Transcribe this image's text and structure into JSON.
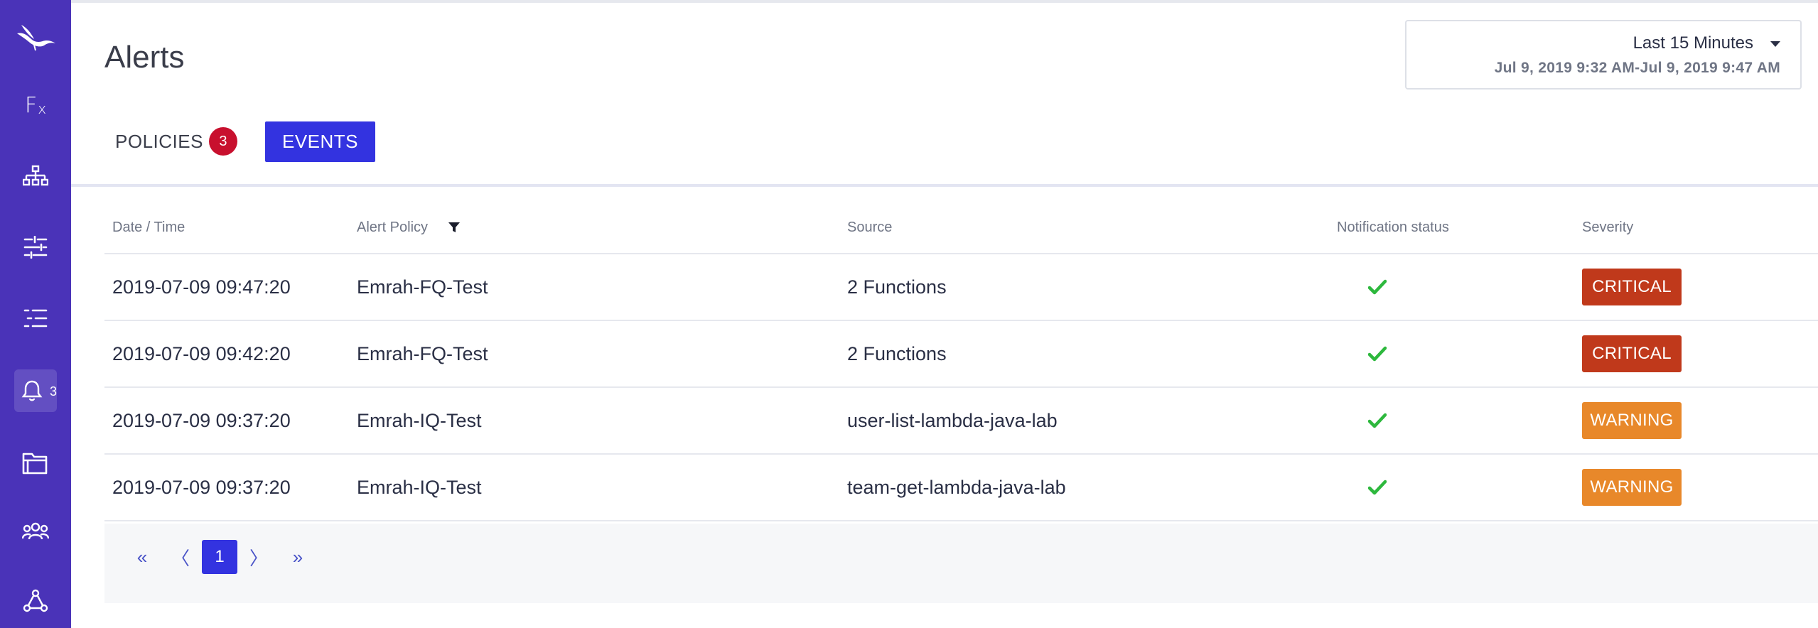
{
  "app": {
    "page_title": "Alerts"
  },
  "sidebar": {
    "accent_color": "#4a33b8",
    "items": [
      {
        "icon": "bird-logo-icon"
      },
      {
        "icon": "functions-icon",
        "label": "F",
        "sub": "x"
      },
      {
        "icon": "hierarchy-icon"
      },
      {
        "icon": "sliders-icon"
      },
      {
        "icon": "list-icon"
      },
      {
        "icon": "bell-icon",
        "badge": "3"
      },
      {
        "icon": "folder-icon"
      },
      {
        "icon": "team-icon"
      },
      {
        "icon": "network-icon"
      }
    ]
  },
  "time_picker": {
    "range_label": "Last 15 Minutes",
    "dates": "Jul 9, 2019 9:32 AM-Jul 9, 2019 9:47 AM"
  },
  "tabs": {
    "policies_label": "POLICIES",
    "policies_badge": "3",
    "events_label": "EVENTS",
    "active": "EVENTS"
  },
  "table": {
    "headers": {
      "date": "Date / Time",
      "policy": "Alert Policy",
      "source": "Source",
      "notification": "Notification status",
      "severity": "Severity"
    },
    "rows": [
      {
        "date": "2019-07-09 09:47:20",
        "policy": "Emrah-FQ-Test",
        "source": "2 Functions",
        "notification": "sent",
        "severity": "CRITICAL"
      },
      {
        "date": "2019-07-09 09:42:20",
        "policy": "Emrah-FQ-Test",
        "source": "2 Functions",
        "notification": "sent",
        "severity": "CRITICAL"
      },
      {
        "date": "2019-07-09 09:37:20",
        "policy": "Emrah-IQ-Test",
        "source": "user-list-lambda-java-lab",
        "notification": "sent",
        "severity": "WARNING"
      },
      {
        "date": "2019-07-09 09:37:20",
        "policy": "Emrah-IQ-Test",
        "source": "team-get-lambda-java-lab",
        "notification": "sent",
        "severity": "WARNING"
      }
    ],
    "severity_colors": {
      "CRITICAL": "#c0391b",
      "WARNING": "#e8882a"
    },
    "check_color": "#2db83d"
  },
  "pagination": {
    "first": "«",
    "prev": "〈",
    "current": "1",
    "next": "〉",
    "last": "»"
  }
}
